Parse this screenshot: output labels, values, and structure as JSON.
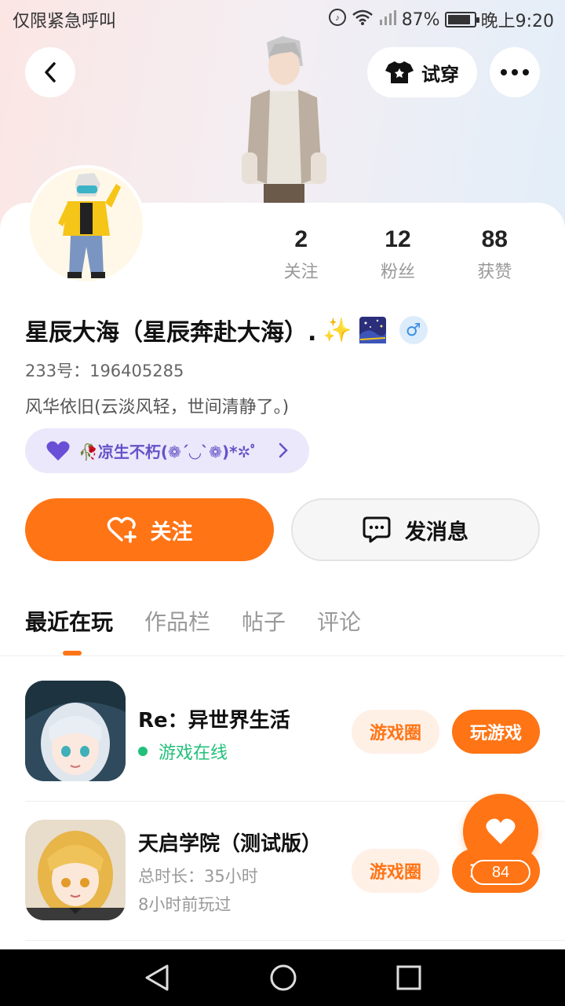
{
  "status_bar": {
    "left_text": "仅限紧急呼叫",
    "battery": "87%",
    "battery_level": 0.87,
    "time": "晚上9:20"
  },
  "header": {
    "try_on_label": "试穿"
  },
  "profile": {
    "stats": [
      {
        "value": "2",
        "label": "关注"
      },
      {
        "value": "12",
        "label": "粉丝"
      },
      {
        "value": "88",
        "label": "获赞"
      }
    ],
    "name": "星辰大海（星辰奔赴大海）.",
    "name_emoji": "✨",
    "gender_symbol": "♂",
    "uid": "233号：196405285",
    "bio": "风华依旧(云淡风轻，世间清静了。)",
    "club": "🥀凉生不朽(❁´◡`❁)*✲ﾟ"
  },
  "actions": {
    "follow_label": "关注",
    "message_label": "发消息"
  },
  "tabs": [
    "最近在玩",
    "作品栏",
    "帖子",
    "评论"
  ],
  "games": [
    {
      "title": "Re：异世界生活",
      "status": "游戏在线",
      "circle_label": "游戏圈",
      "play_label": "玩游戏"
    },
    {
      "title": "天启学院（测试版）",
      "total_time": "总时长：35小时",
      "last_played": "8小时前玩过",
      "circle_label": "游戏圈",
      "play_label": "玩游戏"
    }
  ],
  "like_fab": {
    "count": "84"
  },
  "colors": {
    "accent": "#ff7415",
    "online": "#22c07a",
    "club_text": "#6651c8"
  }
}
